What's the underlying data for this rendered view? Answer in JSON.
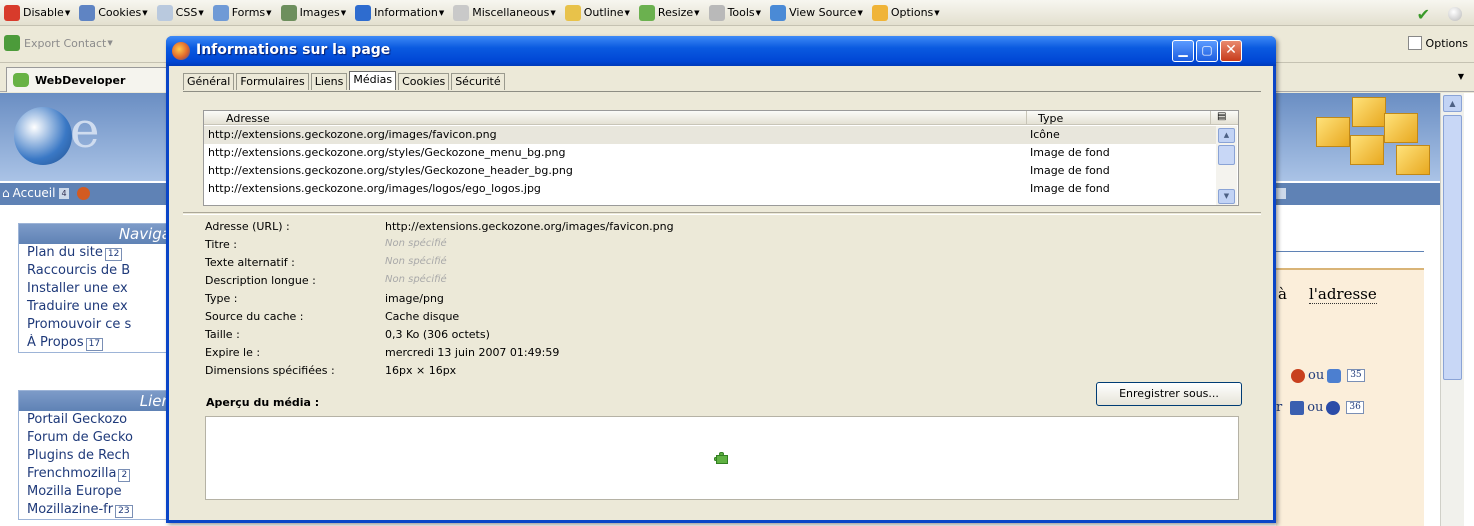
{
  "devbar": {
    "items": [
      {
        "label": "Disable",
        "icon": "disable-icon",
        "color": "#d83b2b"
      },
      {
        "label": "Cookies",
        "icon": "cookies-icon",
        "color": "#5f84c3"
      },
      {
        "label": "CSS",
        "icon": "css-icon",
        "color": "#b9c9de"
      },
      {
        "label": "Forms",
        "icon": "forms-icon",
        "color": "#6f9ad6"
      },
      {
        "label": "Images",
        "icon": "images-icon",
        "color": "#6d8f5d"
      },
      {
        "label": "Information",
        "icon": "information-icon",
        "color": "#2e6ccf"
      },
      {
        "label": "Miscellaneous",
        "icon": "miscellaneous-icon",
        "color": "#c9c9c9"
      },
      {
        "label": "Outline",
        "icon": "outline-icon",
        "color": "#e8c24a"
      },
      {
        "label": "Resize",
        "icon": "resize-icon",
        "color": "#6bb14f"
      },
      {
        "label": "Tools",
        "icon": "tools-icon",
        "color": "#b9b9b9"
      },
      {
        "label": "View Source",
        "icon": "view-source-icon",
        "color": "#4a8ad6"
      },
      {
        "label": "Options",
        "icon": "options-icon",
        "color": "#f0b437"
      }
    ]
  },
  "toolbar2": {
    "export_label": "Export Contact",
    "options_label": "Options"
  },
  "browser_tab": {
    "label": "WebDeveloper"
  },
  "page": {
    "nav_home": "Accueil",
    "nav_home_badge": "4",
    "box1_title": "Naviga",
    "box1_items": [
      {
        "label": "Plan du site",
        "badge": "12"
      },
      {
        "label": "Raccourcis de B",
        "badge": ""
      },
      {
        "label": "Installer une ex",
        "badge": ""
      },
      {
        "label": "Traduire une ex",
        "badge": ""
      },
      {
        "label": "Promouvoir ce s",
        "badge": ""
      },
      {
        "label": "À Propos",
        "badge": "17"
      }
    ],
    "box2_title": "Lien",
    "box2_items": [
      {
        "label": "Portail Geckozo",
        "badge": ""
      },
      {
        "label": "Forum de Gecko",
        "badge": ""
      },
      {
        "label": "Plugins de Rech",
        "badge": ""
      },
      {
        "label": "Frenchmozilla",
        "badge": "2"
      },
      {
        "label": "Mozilla Europe",
        "badge": ""
      },
      {
        "label": "Mozillazine-fr",
        "badge": "23"
      }
    ],
    "right_text_a": "à",
    "right_text_b": "l'adresse",
    "right_ou": "ou",
    "right_badge1": "35",
    "right_r": "r",
    "right_badge2": "36"
  },
  "dialog": {
    "title": "Informations sur la page",
    "tabs": [
      "Général",
      "Formulaires",
      "Liens",
      "Médias",
      "Cookies",
      "Sécurité"
    ],
    "active_tab": "Médias",
    "table": {
      "col_address": "Adresse",
      "col_type": "Type",
      "rows": [
        {
          "address": "http://extensions.geckozone.org/images/favicon.png",
          "type": "Icône"
        },
        {
          "address": "http://extensions.geckozone.org/styles/Geckozone_menu_bg.png",
          "type": "Image de fond"
        },
        {
          "address": "http://extensions.geckozone.org/styles/Geckozone_header_bg.png",
          "type": "Image de fond"
        },
        {
          "address": "http://extensions.geckozone.org/images/logos/ego_logos.jpg",
          "type": "Image de fond"
        }
      ]
    },
    "properties": [
      {
        "label": "Adresse (URL) :",
        "value": "http://extensions.geckozone.org/images/favicon.png",
        "unspecified": false
      },
      {
        "label": "Titre :",
        "value": "Non spécifié",
        "unspecified": true
      },
      {
        "label": "Texte alternatif :",
        "value": "Non spécifié",
        "unspecified": true
      },
      {
        "label": "Description longue :",
        "value": "Non spécifié",
        "unspecified": true
      },
      {
        "label": "Type :",
        "value": "image/png",
        "unspecified": false
      },
      {
        "label": "Source du cache :",
        "value": "Cache disque",
        "unspecified": false
      },
      {
        "label": "Taille :",
        "value": "0,3 Ko (306 octets)",
        "unspecified": false
      },
      {
        "label": "Expire le :",
        "value": "mercredi 13 juin 2007 01:49:59",
        "unspecified": false
      },
      {
        "label": "Dimensions spécifiées :",
        "value": "16px × 16px",
        "unspecified": false
      }
    ],
    "save_button": "Enregistrer sous...",
    "preview_label": "Aperçu du média :"
  }
}
